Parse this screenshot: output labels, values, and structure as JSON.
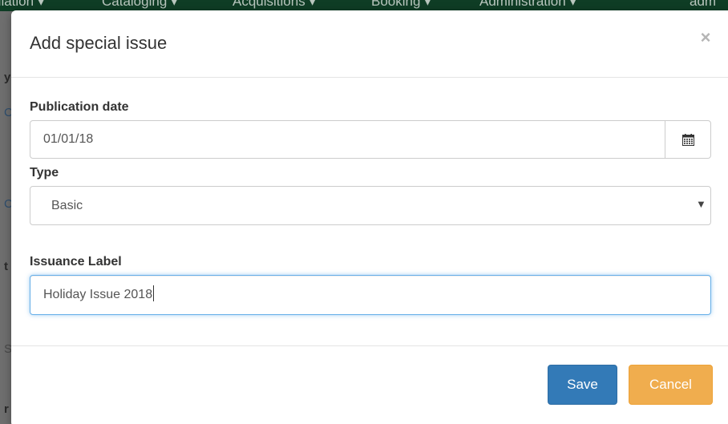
{
  "background": {
    "nav_items": [
      "ulation ▾",
      "Cataloging ▾",
      "Acquisitions ▾",
      "Booking ▾",
      "Administration ▾",
      "adm"
    ],
    "fragments": [
      "y",
      "C",
      "C",
      "t",
      "S",
      "r"
    ]
  },
  "modal": {
    "title": "Add special issue",
    "close_symbol": "×",
    "fields": {
      "publication_date": {
        "label": "Publication date",
        "value": "01/01/18"
      },
      "type": {
        "label": "Type",
        "selected": "Basic"
      },
      "issuance_label": {
        "label": "Issuance Label",
        "value": "Holiday Issue 2018"
      }
    },
    "buttons": {
      "save": "Save",
      "cancel": "Cancel"
    }
  },
  "colors": {
    "primary": "#337ab7",
    "warning": "#f0ad4e",
    "focus": "#66afe9"
  },
  "icons": {
    "calendar": "calendar-icon",
    "dropdown": "caret-down-icon",
    "close": "close-icon"
  }
}
